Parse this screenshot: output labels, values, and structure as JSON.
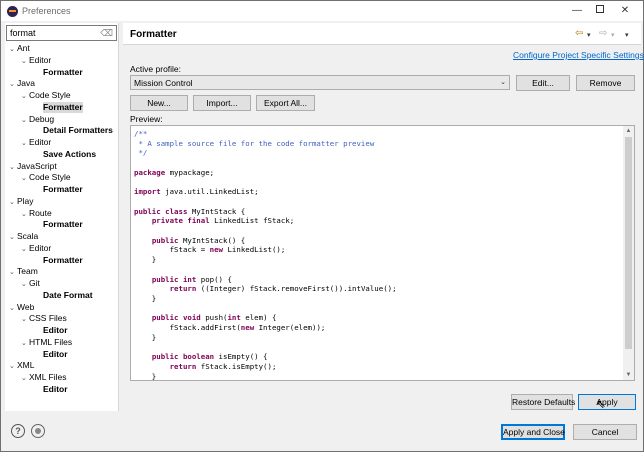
{
  "window": {
    "title": "Preferences",
    "minimize": "—",
    "close": "✕"
  },
  "filter": {
    "value": "format",
    "clear_icon": "⌫"
  },
  "tree": [
    {
      "label": "Ant",
      "depth": 0,
      "bold": false,
      "expanded": true
    },
    {
      "label": "Editor",
      "depth": 1,
      "bold": false,
      "expanded": true
    },
    {
      "label": "Formatter",
      "depth": 2,
      "bold": true,
      "expanded": null
    },
    {
      "label": "Java",
      "depth": 0,
      "bold": false,
      "expanded": true
    },
    {
      "label": "Code Style",
      "depth": 1,
      "bold": false,
      "expanded": true
    },
    {
      "label": "Formatter",
      "depth": 2,
      "bold": true,
      "expanded": null,
      "selected": true
    },
    {
      "label": "Debug",
      "depth": 1,
      "bold": false,
      "expanded": true
    },
    {
      "label": "Detail Formatters",
      "depth": 2,
      "bold": true,
      "expanded": null
    },
    {
      "label": "Editor",
      "depth": 1,
      "bold": false,
      "expanded": true
    },
    {
      "label": "Save Actions",
      "depth": 2,
      "bold": true,
      "expanded": null
    },
    {
      "label": "JavaScript",
      "depth": 0,
      "bold": false,
      "expanded": true
    },
    {
      "label": "Code Style",
      "depth": 1,
      "bold": false,
      "expanded": true
    },
    {
      "label": "Formatter",
      "depth": 2,
      "bold": true,
      "expanded": null
    },
    {
      "label": "Play",
      "depth": 0,
      "bold": false,
      "expanded": true
    },
    {
      "label": "Route",
      "depth": 1,
      "bold": false,
      "expanded": true
    },
    {
      "label": "Formatter",
      "depth": 2,
      "bold": true,
      "expanded": null
    },
    {
      "label": "Scala",
      "depth": 0,
      "bold": false,
      "expanded": true
    },
    {
      "label": "Editor",
      "depth": 1,
      "bold": false,
      "expanded": true
    },
    {
      "label": "Formatter",
      "depth": 2,
      "bold": true,
      "expanded": null
    },
    {
      "label": "Team",
      "depth": 0,
      "bold": false,
      "expanded": true
    },
    {
      "label": "Git",
      "depth": 1,
      "bold": false,
      "expanded": true
    },
    {
      "label": "Date Format",
      "depth": 2,
      "bold": true,
      "expanded": null
    },
    {
      "label": "Web",
      "depth": 0,
      "bold": false,
      "expanded": true
    },
    {
      "label": "CSS Files",
      "depth": 1,
      "bold": false,
      "expanded": true
    },
    {
      "label": "Editor",
      "depth": 2,
      "bold": true,
      "expanded": null
    },
    {
      "label": "HTML Files",
      "depth": 1,
      "bold": false,
      "expanded": true
    },
    {
      "label": "Editor",
      "depth": 2,
      "bold": true,
      "expanded": null
    },
    {
      "label": "XML",
      "depth": 0,
      "bold": false,
      "expanded": true
    },
    {
      "label": "XML Files",
      "depth": 1,
      "bold": false,
      "expanded": true
    },
    {
      "label": "Editor",
      "depth": 2,
      "bold": true,
      "expanded": null
    }
  ],
  "header": {
    "title": "Formatter",
    "back_icon": "⇦",
    "forward_icon": "⇨",
    "dropdown_icon": "▾"
  },
  "config_link": "Configure Project Specific Settings...",
  "profile": {
    "label": "Active profile:",
    "value": "Mission Control",
    "arrow": "⌄"
  },
  "buttons": {
    "edit": "Edit...",
    "remove": "Remove",
    "new": "New...",
    "import": "Import...",
    "export_all": "Export All...",
    "restore_defaults": "Restore Defaults",
    "apply": "Apply",
    "apply_and_close": "Apply and Close",
    "cancel": "Cancel"
  },
  "preview": {
    "label": "Preview:",
    "lines": [
      {
        "text": "/**",
        "style": "comment"
      },
      {
        "text": " * A sample source file for the code formatter preview",
        "style": "comment"
      },
      {
        "text": " */",
        "style": "comment"
      },
      {
        "text": "",
        "style": "plain"
      },
      {
        "parts": [
          {
            "t": "package",
            "s": "kw"
          },
          {
            "t": " mypackage;",
            "s": "plain"
          }
        ]
      },
      {
        "text": "",
        "style": "plain"
      },
      {
        "parts": [
          {
            "t": "import",
            "s": "kw"
          },
          {
            "t": " java.util.LinkedList;",
            "s": "plain"
          }
        ]
      },
      {
        "text": "",
        "style": "plain"
      },
      {
        "parts": [
          {
            "t": "public class",
            "s": "kw"
          },
          {
            "t": " MyIntStack {",
            "s": "plain"
          }
        ]
      },
      {
        "parts": [
          {
            "t": "    ",
            "s": "plain"
          },
          {
            "t": "private final",
            "s": "kw"
          },
          {
            "t": " LinkedList fStack;",
            "s": "plain"
          }
        ]
      },
      {
        "text": "",
        "style": "plain"
      },
      {
        "parts": [
          {
            "t": "    ",
            "s": "plain"
          },
          {
            "t": "public",
            "s": "kw"
          },
          {
            "t": " MyIntStack() {",
            "s": "plain"
          }
        ]
      },
      {
        "parts": [
          {
            "t": "        fStack = ",
            "s": "plain"
          },
          {
            "t": "new",
            "s": "kw"
          },
          {
            "t": " LinkedList();",
            "s": "plain"
          }
        ]
      },
      {
        "text": "    }",
        "style": "plain"
      },
      {
        "text": "",
        "style": "plain"
      },
      {
        "parts": [
          {
            "t": "    ",
            "s": "plain"
          },
          {
            "t": "public int",
            "s": "kw"
          },
          {
            "t": " pop() {",
            "s": "plain"
          }
        ]
      },
      {
        "parts": [
          {
            "t": "        ",
            "s": "plain"
          },
          {
            "t": "return",
            "s": "kw"
          },
          {
            "t": " ((Integer) fStack.removeFirst()).intValue();",
            "s": "plain"
          }
        ]
      },
      {
        "text": "    }",
        "style": "plain"
      },
      {
        "text": "",
        "style": "plain"
      },
      {
        "parts": [
          {
            "t": "    ",
            "s": "plain"
          },
          {
            "t": "public void",
            "s": "kw"
          },
          {
            "t": " push(",
            "s": "plain"
          },
          {
            "t": "int",
            "s": "kw"
          },
          {
            "t": " elem) {",
            "s": "plain"
          }
        ]
      },
      {
        "parts": [
          {
            "t": "        fStack.addFirst(",
            "s": "plain"
          },
          {
            "t": "new",
            "s": "kw"
          },
          {
            "t": " Integer(elem));",
            "s": "plain"
          }
        ]
      },
      {
        "text": "    }",
        "style": "plain"
      },
      {
        "text": "",
        "style": "plain"
      },
      {
        "parts": [
          {
            "t": "    ",
            "s": "plain"
          },
          {
            "t": "public boolean",
            "s": "kw"
          },
          {
            "t": " isEmpty() {",
            "s": "plain"
          }
        ]
      },
      {
        "parts": [
          {
            "t": "        ",
            "s": "plain"
          },
          {
            "t": "return",
            "s": "kw"
          },
          {
            "t": " fStack.isEmpty();",
            "s": "plain"
          }
        ]
      },
      {
        "text": "    }",
        "style": "plain"
      }
    ]
  },
  "bottom": {
    "help_icon": "?"
  },
  "colors": {
    "accent": "#0078d7",
    "link": "#0066cc",
    "keyword": "#7f0055",
    "comment": "#3f5fbf"
  }
}
